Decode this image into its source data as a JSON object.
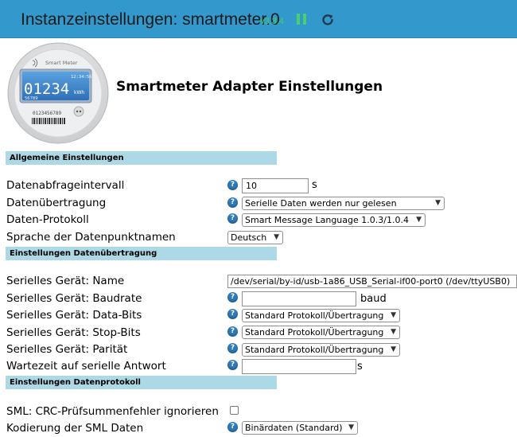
{
  "header": {
    "title": "Instanzeinstellungen: smartmeter.0",
    "version": "v3.3.4",
    "colors": {
      "bar": "#3399cc",
      "version": "#39d35c"
    }
  },
  "logo": {
    "brand": "Smart Meter",
    "time": "12:34:56",
    "reading": "01234",
    "unit": "kWh",
    "code": "56789",
    "serial": "0123456789"
  },
  "page_title": "Smartmeter Adapter Einstellungen",
  "sections": {
    "general": "Allgemeine Einstellungen",
    "transfer": "Einstellungen Datenübertragung",
    "protocol": "Einstellungen Datenprotokoll"
  },
  "general": {
    "interval_label": "Datenabfrageintervall",
    "interval_value": "10",
    "interval_unit": "s",
    "transfer_label": "Datenübertragung",
    "transfer_value": "Serielle Daten werden nur gelesen",
    "protocol_label": "Daten-Protokoll",
    "protocol_value": "Smart Message Language 1.0.3/1.0.4",
    "language_label": "Sprache der Datenpunktnamen",
    "language_value": "Deutsch"
  },
  "transfer": {
    "device_label": "Serielles Gerät: Name",
    "device_value": "/dev/serial/by-id/usb-1a86_USB_Serial-if00-port0 (/dev/ttyUSB0)",
    "baud_label": "Serielles Gerät: Baudrate",
    "baud_value": "",
    "baud_unit": "baud",
    "databits_label": "Serielles Gerät: Data-Bits",
    "databits_value": "Standard Protokoll/Übertragung",
    "stopbits_label": "Serielles Gerät: Stop-Bits",
    "stopbits_value": "Standard Protokoll/Übertragung",
    "parity_label": "Serielles Gerät: Parität",
    "parity_value": "Standard Protokoll/Übertragung",
    "wait_label": "Wartezeit auf serielle Antwort",
    "wait_value": "",
    "wait_unit": "s"
  },
  "protocol": {
    "crc_label": "SML: CRC-Prüfsummenfehler ignorieren",
    "crc_checked": false,
    "encoding_label": "Kodierung der SML Daten",
    "encoding_value": "Binärdaten (Standard)"
  },
  "icons": {
    "help": "?",
    "pause": "pause-icon",
    "reload": "reload-icon",
    "chevron": "chevron-down-icon"
  }
}
